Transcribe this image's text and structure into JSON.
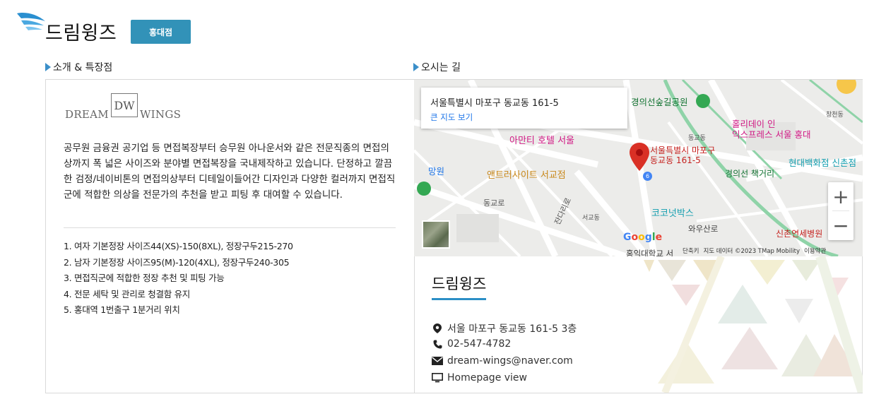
{
  "header": {
    "brand": "드림윙즈",
    "branch": "홍대점"
  },
  "sections": {
    "intro_label": "소개 & 특장점",
    "directions_label": "오시는 길"
  },
  "intro": {
    "logo_left": "DREAM",
    "logo_mark": "DW",
    "logo_right": "WINGS",
    "description": "공무원 금융권 공기업 등 면접복장부터 승무원 아나운서와 같은 전문직종의 면접의상까지 폭 넓은 사이즈와 분야별 면접복장을 국내제작하고 있습니다. 단정하고 깔끔한 검정/네이비톤의 면접의상부터 디테일이들어간 디자인과 다양한 컬러까지 면접직군에 적합한 의상을 전문가의 추천을 받고 피팅 후 대여할 수 있습니다.",
    "features": [
      "1. 여자 기본정장 사이즈44(XS)-150(8XL), 정장구두215-270",
      "2. 남자 기본정장 사이즈95(M)-120(4XL), 정장구두240-305",
      "3. 면접직군에 적합한 정장 추천 및 피팅 가능",
      "4. 전문 세탁 및 관리로 청결함 유지",
      "5. 홍대역 1번출구 1분거리 위치"
    ]
  },
  "map": {
    "popup_address": "서울특별시 마포구 동교동 161-5",
    "popup_link": "큰 지도 보기",
    "marker_label_1": "서울특별시 마포구",
    "marker_label_2": "동교동 161-5",
    "zoom_in": "+",
    "zoom_out": "−",
    "google": [
      "G",
      "o",
      "o",
      "g",
      "l",
      "e"
    ],
    "footer_shortcuts": "단축키",
    "footer_data": "지도 데이터 ©2023 TMap Mobility",
    "footer_terms": "이용약관",
    "places": {
      "gyeongui_park": "경의선숲길공원",
      "holiday_inn_1": "홀리데이 인",
      "holiday_inn_2": "익스프레스 서울 홍대",
      "amanti": "아만티 호텔 서울",
      "anthracite": "앤트러사이트 서교점",
      "mangwon": "망원",
      "hyundai": "현대백화점 신촌점",
      "gyeongui_book": "경의선 책거리",
      "kokonut": "코코넛박스",
      "wausanro": "와우산로",
      "hongik": "홍익대학교 서",
      "severance": "신촌연세병원",
      "dongkyo": "동교동",
      "donggyo_ro": "동교로",
      "jandari_ro": "잔다리로",
      "wausan_gil": "와우산로",
      "seogyo": "서교동",
      "changcheon": "창천동",
      "route6": "6"
    },
    "colors": {
      "pin": "#d93025",
      "label_red": "#c5221f",
      "label_pink": "#d01884",
      "label_teal": "#129eaf",
      "label_orange": "#c88719",
      "road_green": "#8fd3a8"
    }
  },
  "info": {
    "name": "드림윙즈",
    "address": "서울 마포구 동교동 161-5 3층",
    "phone": "02-547-4782",
    "email": "dream-wings@naver.com",
    "homepage": "Homepage view"
  },
  "icons": {
    "location": "map-pin-icon",
    "phone": "phone-icon",
    "email": "envelope-icon",
    "homepage": "monitor-icon"
  }
}
